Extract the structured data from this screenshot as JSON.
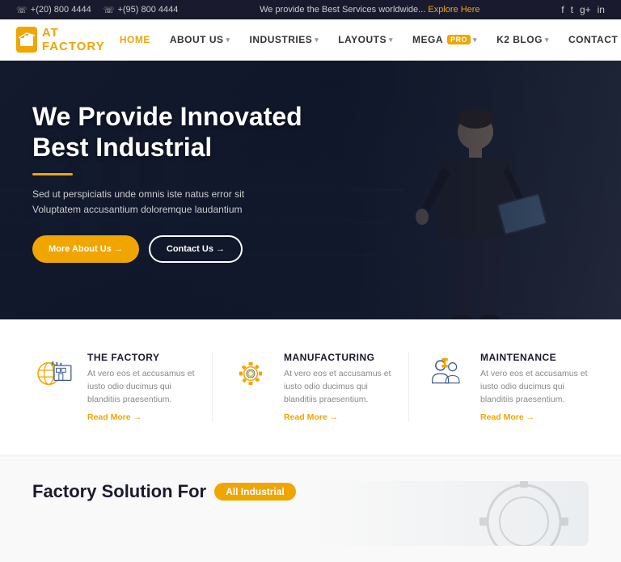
{
  "topbar": {
    "phone1": "+(20) 800 4444",
    "phone2": "+(95) 800 4444",
    "tagline": "We provide the Best Services worldwide...",
    "explore_link": "Explore Here",
    "social": [
      "f",
      "t",
      "g+",
      "in"
    ]
  },
  "navbar": {
    "logo_text_prefix": "AT ",
    "logo_text_main": "FACTORY",
    "links": [
      {
        "label": "HOME",
        "active": true,
        "has_dropdown": false
      },
      {
        "label": "ABOUT US",
        "active": false,
        "has_dropdown": true
      },
      {
        "label": "INDUSTRIES",
        "active": false,
        "has_dropdown": true
      },
      {
        "label": "LAYOUTS",
        "active": false,
        "has_dropdown": true
      },
      {
        "label": "MEGA",
        "active": false,
        "has_dropdown": true,
        "badge": "PRO"
      },
      {
        "label": "K2 BLOG",
        "active": false,
        "has_dropdown": true
      },
      {
        "label": "CONTACT",
        "active": false,
        "has_dropdown": false
      }
    ]
  },
  "hero": {
    "title_line1": "We Provide Innovated",
    "title_line2": "Best Industrial",
    "subtitle": "Sed ut perspiciatis unde omnis iste natus error sit Voluptatem accusantium doloremque laudantium",
    "btn_primary": "More About Us →",
    "btn_outline": "Contact Us →"
  },
  "services": [
    {
      "id": "factory",
      "title": "THE FACTORY",
      "desc": "At vero eos et accusamus et iusto odio ducimus qui blanditiis praesentium.",
      "link": "Read More →"
    },
    {
      "id": "manufacturing",
      "title": "MANUFACTURING",
      "desc": "At vero eos et accusamus et iusto odio ducimus qui blanditiis praesentium.",
      "link": "Read More →"
    },
    {
      "id": "maintenance",
      "title": "MAINTENANCE",
      "desc": "At vero eos et accusamus et iusto odio ducimus qui blanditiis praesentium.",
      "link": "Read More →"
    }
  ],
  "factory_solution": {
    "title": "Factory Solution For",
    "badge": "All Industrial"
  },
  "colors": {
    "accent": "#f0a500",
    "dark": "#1a1a2e",
    "text": "#555"
  }
}
